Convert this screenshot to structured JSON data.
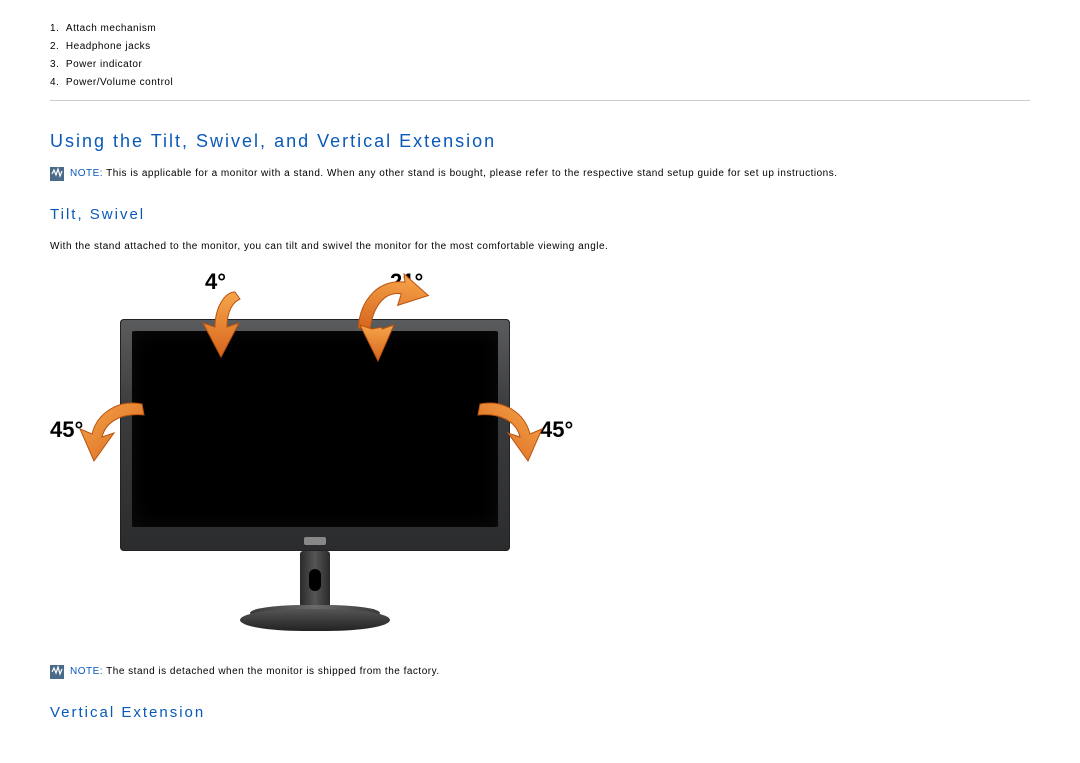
{
  "list": {
    "items": [
      "Attach mechanism",
      "Headphone jacks",
      "Power indicator",
      "Power/Volume control"
    ]
  },
  "headings": {
    "main": "Using the Tilt, Swivel, and Vertical Extension",
    "tilt_swivel": "Tilt, Swivel",
    "vertical_extension": "Vertical Extension"
  },
  "notes": {
    "label": "NOTE:",
    "note1_text": " This is applicable for a monitor with a stand. When any other stand is bought, please refer to the respective stand setup guide for set up instructions.",
    "note2_text": " The stand is detached when the monitor is shipped from the factory."
  },
  "body": {
    "tilt_swivel_desc": "With the stand attached to the monitor, you can tilt and swivel the monitor for the most comfortable viewing angle."
  },
  "figure": {
    "angle_4": "4°",
    "angle_21": "21°",
    "angle_45_left": "45°",
    "angle_45_right": "45°"
  }
}
